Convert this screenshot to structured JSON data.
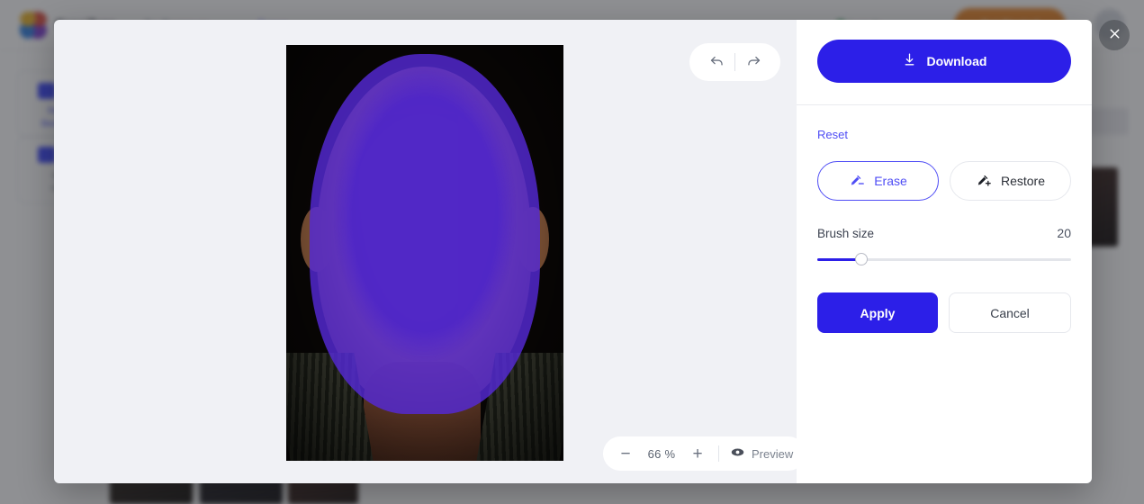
{
  "background": {
    "brand": "Erasifyer",
    "nav": [
      {
        "label": "Bg Remover"
      },
      {
        "label": "Erase"
      },
      {
        "label": "Log In"
      }
    ],
    "cta_label": "Get Started",
    "tiles": [
      {
        "line1": "Remove",
        "line2": "Background"
      },
      {
        "line1": "Erase",
        "line2": "Object"
      }
    ]
  },
  "modal": {
    "close_label": "Close",
    "close_icon": "close-icon"
  },
  "canvas": {
    "history": {
      "undo_icon": "undo-arrow-icon",
      "redo_icon": "redo-arrow-icon",
      "undo_label": "Undo",
      "redo_label": "Redo"
    },
    "zoom": {
      "minus_label": "−",
      "plus_label": "+",
      "value": "66 %",
      "preview_label": "Preview",
      "preview_icon": "eye-icon"
    },
    "image_alt": "Portrait of an elderly man with purple erase mask applied"
  },
  "controls": {
    "download_label": "Download",
    "download_icon": "download-arrow-icon",
    "reset_label": "Reset",
    "modes": [
      {
        "label": "Erase",
        "icon": "brush-minus-icon",
        "active": true
      },
      {
        "label": "Restore",
        "icon": "brush-plus-icon",
        "active": false
      }
    ],
    "brush": {
      "label": "Brush size",
      "value": "20"
    },
    "apply_label": "Apply",
    "cancel_label": "Cancel"
  },
  "colors": {
    "accent": "#2c1fe8",
    "accent_link": "#4f4df5",
    "mask": "#4b23c9",
    "panel_bg": "#f0f1f5",
    "cta": "#f08a2a"
  }
}
